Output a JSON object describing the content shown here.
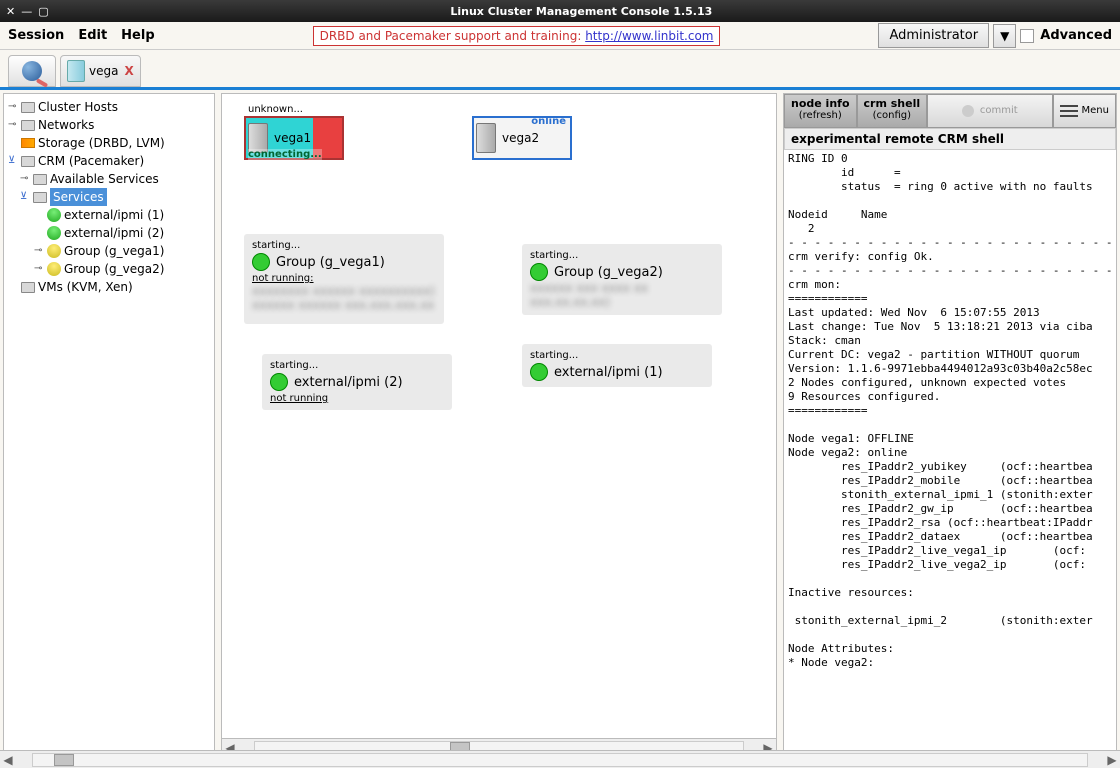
{
  "titlebar": {
    "title": "Linux Cluster Management Console 1.5.13"
  },
  "menubar": {
    "session": "Session",
    "edit": "Edit",
    "help": "Help",
    "support_text": "DRBD and Pacemaker support and training: ",
    "support_link": "http://www.linbit.com",
    "admin_label": "Administrator",
    "advanced_label": "Advanced"
  },
  "tabs": {
    "node_tab": "vega",
    "close": "X"
  },
  "tree": {
    "cluster_hosts": "Cluster Hosts",
    "networks": "Networks",
    "storage": "Storage (DRBD, LVM)",
    "crm": "CRM (Pacemaker)",
    "available_services": "Available Services",
    "services": "Services",
    "ipmi1": "external/ipmi (1)",
    "ipmi2": "external/ipmi (2)",
    "group1": "Group (g_vega1)",
    "group2": "Group (g_vega2)",
    "vms": "VMs (KVM, Xen)"
  },
  "canvas": {
    "vega1_name": "vega1",
    "vega1_top": "unknown...",
    "vega1_bot": "connecting...",
    "vega2_name": "vega2",
    "vega2_online": "online",
    "group1_label": "Group (g_vega1)",
    "group2_label": "Group (g_vega2)",
    "starting": "starting...",
    "not_running": "not running:",
    "not_running2": "not running",
    "ipmi1_label": "external/ipmi (1)",
    "ipmi2_label": "external/ipmi (2)"
  },
  "right": {
    "node_info_top": "node info",
    "node_info_bot": "(refresh)",
    "crm_shell_top": "crm shell",
    "crm_shell_bot": "(config)",
    "commit": "commit",
    "menu": "Menu",
    "shell_title": "experimental remote CRM shell"
  },
  "shell_lines": [
    "RING ID 0",
    "        id      = ",
    "        status  = ring 0 active with no faults",
    "",
    "Nodeid     Name",
    "   2       ",
    "- - - - - - - - - - - - - - - - - - - - - - - - - - - - - -",
    "crm verify: config Ok.",
    "- - - - - - - - - - - - - - - - - - - - - - - - - - - - - -",
    "crm mon:",
    "============",
    "Last updated: Wed Nov  6 15:07:55 2013",
    "Last change: Tue Nov  5 13:18:21 2013 via ciba",
    "Stack: cman",
    "Current DC: vega2 - partition WITHOUT quorum",
    "Version: 1.1.6-9971ebba4494012a93c03b40a2c58ec",
    "2 Nodes configured, unknown expected votes",
    "9 Resources configured.",
    "============",
    "",
    "Node vega1: OFFLINE",
    "Node vega2: online",
    "        res_IPaddr2_yubikey     (ocf::heartbea",
    "        res_IPaddr2_mobile      (ocf::heartbea",
    "        stonith_external_ipmi_1 (stonith:exter",
    "        res_IPaddr2_gw_ip       (ocf::heartbea",
    "        res_IPaddr2_rsa (ocf::heartbeat:IPaddr",
    "        res_IPaddr2_dataex      (ocf::heartbea",
    "        res_IPaddr2_live_vega1_ip       (ocf:",
    "        res_IPaddr2_live_vega2_ip       (ocf:",
    "",
    "Inactive resources:",
    "",
    " stonith_external_ipmi_2        (stonith:exter",
    "",
    "Node Attributes:",
    "* Node vega2:"
  ]
}
